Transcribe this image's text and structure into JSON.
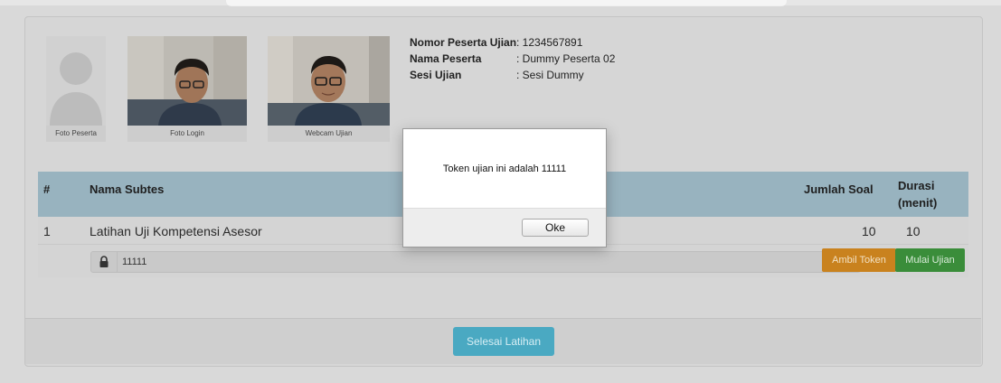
{
  "photos": {
    "peserta_caption": "Foto Peserta",
    "login_caption": "Foto Login",
    "webcam_caption": "Webcam Ujian"
  },
  "info": {
    "nomor_label": "Nomor Peserta Ujian",
    "nomor_value": ": 1234567891",
    "nama_label": "Nama Peserta",
    "nama_value": ": Dummy Peserta 02",
    "sesi_label": "Sesi Ujian",
    "sesi_value": ": Sesi Dummy"
  },
  "table": {
    "headers": {
      "no": "#",
      "nama": "Nama Subtes",
      "jumlah": "Jumlah Soal",
      "durasi_line1": "Durasi",
      "durasi_line2": "(menit)"
    },
    "rows": [
      {
        "no": "1",
        "nama": "Latihan Uji Kompetensi Asesor",
        "jumlah": "10",
        "durasi": "10",
        "token_value": "11111",
        "lock_icon": "lock-icon",
        "ambil_label": "Ambil Token",
        "mulai_label": "Mulai Ujian"
      }
    ]
  },
  "footer": {
    "selesai_label": "Selesai Latihan"
  },
  "modal": {
    "message": "Token ujian ini adalah 11111",
    "ok_label": "Oke"
  },
  "colors": {
    "header_bg": "#98b3bf",
    "ambil_button": "#c9821e",
    "mulai_button": "#3a8d3a",
    "selesai_button": "#4aa9c2"
  }
}
